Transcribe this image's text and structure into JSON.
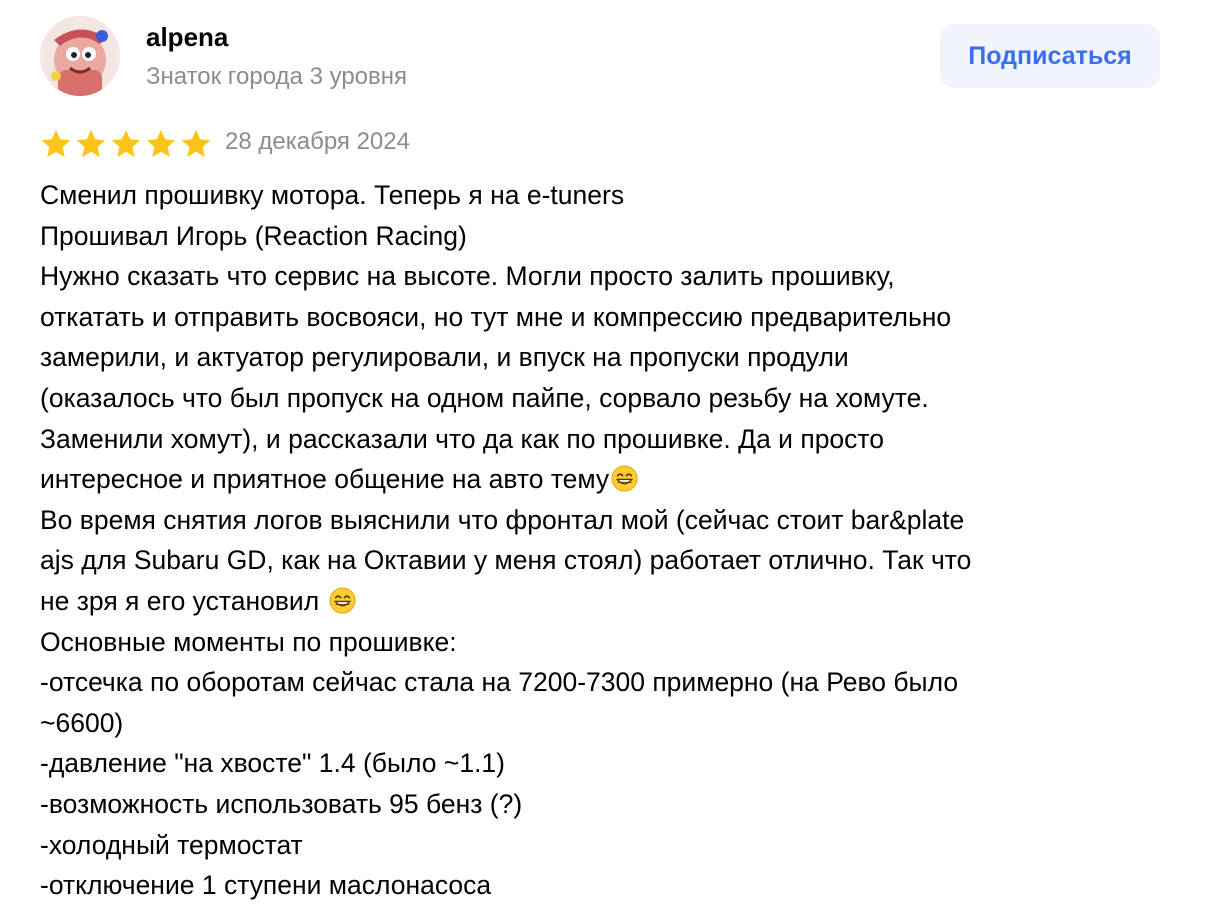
{
  "author": {
    "name": "alpena",
    "level": "Знаток города 3 уровня",
    "avatar": "avatar-cartoon-character"
  },
  "subscribe_button": {
    "label": "Подписаться",
    "color": "#3a6ff0",
    "background": "#f1f4fb"
  },
  "rating": {
    "stars": 5,
    "max_stars": 5,
    "star_color": "#fcc419",
    "icon": "star-icon"
  },
  "date": "28 декабря 2024",
  "review_lines": [
    "Сменил прошивку мотора. Теперь я на e-tuners",
    "Прошивал Игорь (Reaction Racing)",
    "Нужно сказать что сервис на высоте. Могли просто залить прошивку,",
    "откатать и отправить восвояси, но тут мне и компрессию предварительно",
    "замерили, и актуатор регулировали, и впуск на пропуски продули",
    "(оказалось что был пропуск на одном пайпе, сорвало резьбу на хомуте.",
    "Заменили хомут), и рассказали что да как по прошивке. Да и просто",
    "интересное и приятное общение на авто тему",
    "Во время снятия логов выяснили что фронтал мой (сейчас стоит bar&plate",
    "ajs для Subaru GD, как на Октавии у меня стоял) работает отлично. Так что",
    "не зря я его установил ",
    "Основные моменты по прошивке:",
    "-отсечка по оборотам сейчас стала на 7200-7300 примерно (на Рево было",
    "~6600)",
    "-давление \"на хвосте\" 1.4 (было ~1.1)",
    "-возможность использовать 95 бенз (?)",
    "-холодный термостат",
    "-отключение 1 ступени маслонасоса"
  ],
  "emoji": {
    "name": "grinning-face-icon",
    "after_lines": [
      7,
      10
    ]
  }
}
